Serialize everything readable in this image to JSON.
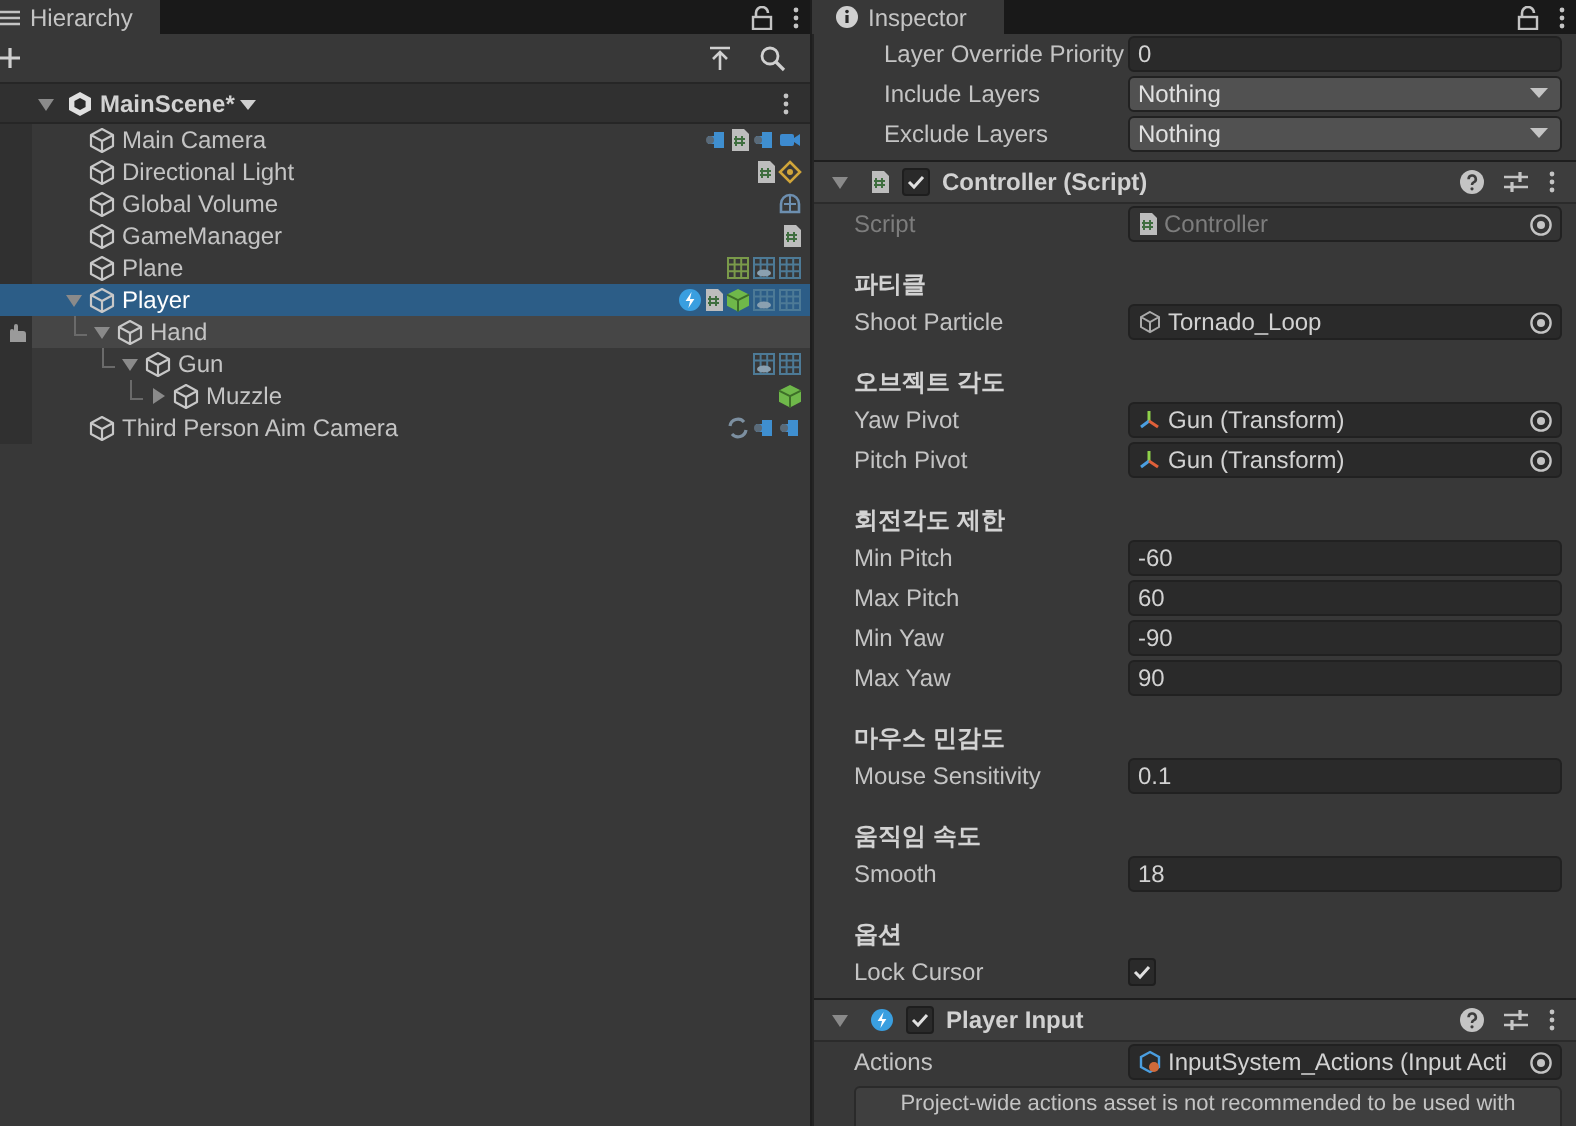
{
  "hierarchy": {
    "tab": "Hierarchy",
    "scene": {
      "name": "MainScene*",
      "expanded": true
    },
    "items": [
      {
        "name": "Main Camera",
        "selected": false,
        "hovered": false,
        "icons": [
          {
            "kind": "cinemachine"
          },
          {
            "kind": "script"
          },
          {
            "kind": "cinemachine"
          },
          {
            "kind": "camera"
          }
        ]
      },
      {
        "name": "Directional Light",
        "selected": false,
        "hovered": false,
        "icons": [
          {
            "kind": "script"
          },
          {
            "kind": "light"
          }
        ]
      },
      {
        "name": "Global Volume",
        "selected": false,
        "hovered": false,
        "icons": [
          {
            "kind": "volume"
          }
        ]
      },
      {
        "name": "GameManager",
        "selected": false,
        "hovered": false,
        "icons": [
          {
            "kind": "script"
          }
        ]
      },
      {
        "name": "Plane",
        "selected": false,
        "hovered": false,
        "icons": [
          {
            "kind": "grid-green"
          },
          {
            "kind": "grid-eye"
          },
          {
            "kind": "grid"
          }
        ]
      },
      {
        "name": "Player",
        "selected": true,
        "hovered": false,
        "expanded": true,
        "icons": [
          {
            "kind": "input"
          },
          {
            "kind": "script"
          },
          {
            "kind": "cube"
          },
          {
            "kind": "grid-eye"
          },
          {
            "kind": "grid"
          }
        ],
        "children": [
          {
            "name": "Hand",
            "selected": false,
            "hovered": true,
            "expanded": true,
            "children": [
              {
                "name": "Gun",
                "selected": false,
                "hovered": false,
                "expanded": true,
                "icons": [
                  {
                    "kind": "grid-eye"
                  },
                  {
                    "kind": "grid"
                  }
                ],
                "children": [
                  {
                    "name": "Muzzle",
                    "selected": false,
                    "hovered": false,
                    "expanded": false,
                    "icons": [
                      {
                        "kind": "cube"
                      }
                    ]
                  }
                ]
              }
            ]
          }
        ]
      },
      {
        "name": "Third Person Aim Camera",
        "selected": false,
        "hovered": false,
        "icons": [
          {
            "kind": "swap"
          },
          {
            "kind": "cinemachine"
          },
          {
            "kind": "cinemachine"
          }
        ]
      }
    ]
  },
  "inspector": {
    "tab": "Inspector",
    "top_fields": [
      {
        "kind": "text",
        "label": "Layer Override Priority",
        "value": "0"
      },
      {
        "kind": "dropdown",
        "label": "Include Layers",
        "value": "Nothing"
      },
      {
        "kind": "dropdown",
        "label": "Exclude Layers",
        "value": "Nothing"
      }
    ],
    "components": [
      {
        "title": "Controller (Script)",
        "icon": {
          "kind": "script"
        },
        "enabled": true,
        "expanded": true,
        "fields": [
          {
            "kind": "object",
            "label": "Script",
            "value": "Controller",
            "asset": {
              "kind": "script"
            },
            "disabled": true
          },
          {
            "kind": "header",
            "label": "파티클"
          },
          {
            "kind": "object",
            "label": "Shoot Particle",
            "value": "Tornado_Loop",
            "asset": {
              "kind": "prefab"
            }
          },
          {
            "kind": "header",
            "label": "오브젝트 각도"
          },
          {
            "kind": "object",
            "label": "Yaw Pivot",
            "value": "Gun (Transform)",
            "asset": {
              "kind": "transform"
            }
          },
          {
            "kind": "object",
            "label": "Pitch Pivot",
            "value": "Gun (Transform)",
            "asset": {
              "kind": "transform"
            }
          },
          {
            "kind": "header",
            "label": "회전각도 제한"
          },
          {
            "kind": "text",
            "label": "Min Pitch",
            "value": "-60"
          },
          {
            "kind": "text",
            "label": "Max Pitch",
            "value": "60"
          },
          {
            "kind": "text",
            "label": "Min Yaw",
            "value": "-90"
          },
          {
            "kind": "text",
            "label": "Max Yaw",
            "value": "90"
          },
          {
            "kind": "header",
            "label": "마우스 민감도"
          },
          {
            "kind": "text",
            "label": "Mouse Sensitivity",
            "value": "0.1"
          },
          {
            "kind": "header",
            "label": "움직임 속도"
          },
          {
            "kind": "text",
            "label": "Smooth",
            "value": "18"
          },
          {
            "kind": "header",
            "label": "옵션"
          },
          {
            "kind": "checkbox",
            "label": "Lock Cursor",
            "checked": true
          }
        ]
      },
      {
        "title": "Player Input",
        "icon": {
          "kind": "input"
        },
        "enabled": true,
        "expanded": true,
        "fields": [
          {
            "kind": "object",
            "label": "Actions",
            "value": "InputSystem_Actions (Input Acti",
            "asset": {
              "kind": "input-asset"
            }
          },
          {
            "kind": "helpbox",
            "text": "Project-wide actions asset is not recommended to be used with"
          }
        ]
      }
    ]
  }
}
